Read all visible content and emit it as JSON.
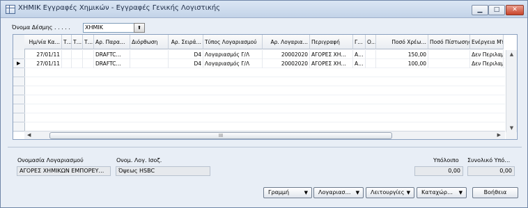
{
  "window": {
    "title": "ΧΗΜΙΚ Εγγραφές Χημικών - Εγγραφές Γενικής Λογιστικής",
    "min_icon": "minimize-icon",
    "max_icon": "maximize-icon",
    "close_icon": "close-icon",
    "min_glyph": "▁",
    "max_glyph": "□",
    "close_glyph": "✕"
  },
  "batch": {
    "label": "Όνομα Δέσμης  .  .  .  .  .",
    "value": "ΧΗΜΙΚ",
    "lookup_glyph": "⬆"
  },
  "grid": {
    "columns": [
      "Ημ/νία Κα…",
      "Τ…",
      "Τ…",
      "Τ…",
      "Αρ. Παρα…",
      "Διόρθωση",
      "Αρ. Σειρά…",
      "Τύπος Λογαριασμού",
      "Αρ. Λογαρια…",
      "Περιγραφή",
      "Γ…",
      "Ο…",
      "Ποσό Χρέω…",
      "Ποσό Πίστωσης",
      "Ενέργεια ΜΥΦ"
    ],
    "rows": [
      [
        "27/01/11",
        "",
        "",
        "",
        "DRAFTC…",
        "",
        "D4",
        "Λογαριασμός Γ/Λ",
        "20002020",
        "ΑΓΟΡΕΣ ΧΗ…",
        "Α…",
        "",
        "150,00",
        "",
        "Δεν Περιλαμ…"
      ],
      [
        "27/01/11",
        "",
        "",
        "",
        "DRAFTC…",
        "",
        "D4",
        "Λογαριασμός Γ/Λ",
        "20002020",
        "ΑΓΟΡΕΣ ΧΗ…",
        "Α…",
        "",
        "100,00",
        "",
        "Δεν Περιλαμ…"
      ]
    ],
    "current_row_glyph": "▶",
    "scroll_up_glyph": "▲",
    "scroll_down_glyph": "▼",
    "scroll_left_glyph": "◀",
    "scroll_right_glyph": "▶",
    "thumb_grip": "III"
  },
  "footer": {
    "account_name_label": "Ονομασία Λογαριασμού",
    "account_name_value": "ΑΓΟΡΕΣ ΧΗΜΙΚΩΝ ΕΜΠΟΡΕΥ…",
    "balancing_account_label": "Ονομ. Λογ. Ισοζ.",
    "balancing_account_value": "Όψεως HSBC",
    "balance_label": "Υπόλοιπο",
    "balance_value": "0,00",
    "total_balance_label": "Συνολικό Υπό…",
    "total_balance_value": "0,00"
  },
  "buttons": {
    "line": "Γραμμή",
    "account": "Λογαριασ…",
    "functions": "Λειτουργίες",
    "post": "Καταχώρ…",
    "help": "Βοήθεια",
    "dropdown_glyph": "▼"
  },
  "colors": {
    "title_bar": "#c3d3e8",
    "close_button": "#c8442b",
    "grid_border": "#8aa0bf"
  }
}
